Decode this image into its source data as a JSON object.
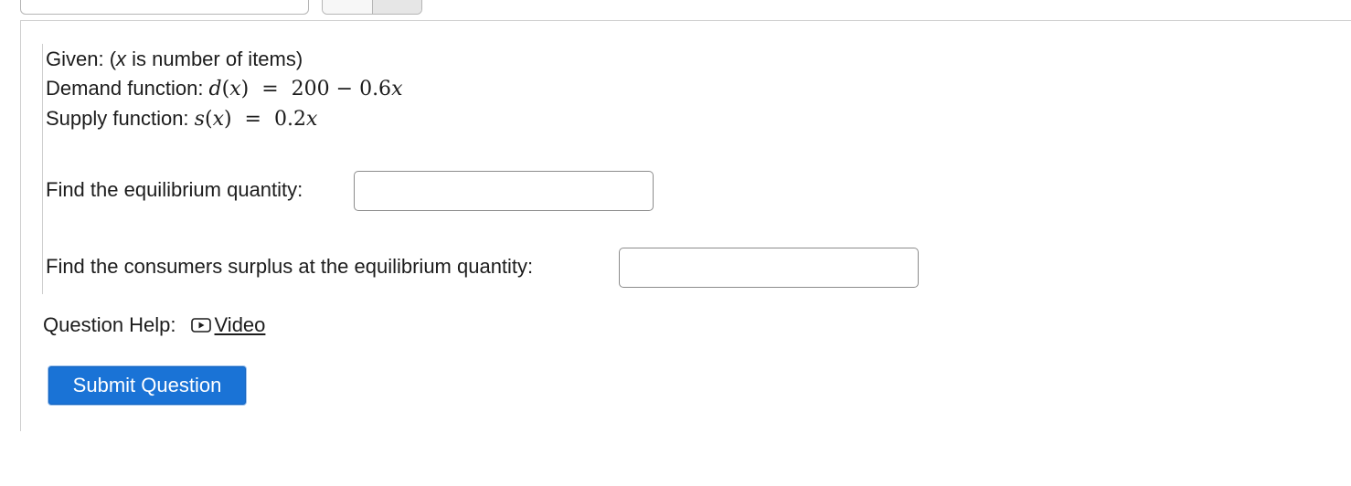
{
  "question": {
    "given_prefix": "Given: (",
    "given_var": "x",
    "given_suffix": " is number of items)",
    "demand_label": "Demand function: ",
    "demand_fn_name": "d",
    "demand_fn_var": "x",
    "demand_rhs": "200 − 0.6",
    "demand_rhs_var": "x",
    "supply_label": "Supply function: ",
    "supply_fn_name": "s",
    "supply_fn_var": "x",
    "supply_rhs": "0.2",
    "supply_rhs_var": "x",
    "q1_label": "Find the equilibrium quantity:",
    "q1_value": "",
    "q2_label": "Find the consumers surplus at the equilibrium quantity:",
    "q2_value": ""
  },
  "help": {
    "label": "Question Help:",
    "video_label": "Video",
    "icon": "video-play-icon"
  },
  "submit": {
    "label": "Submit Question",
    "color": "#1a73d6"
  }
}
